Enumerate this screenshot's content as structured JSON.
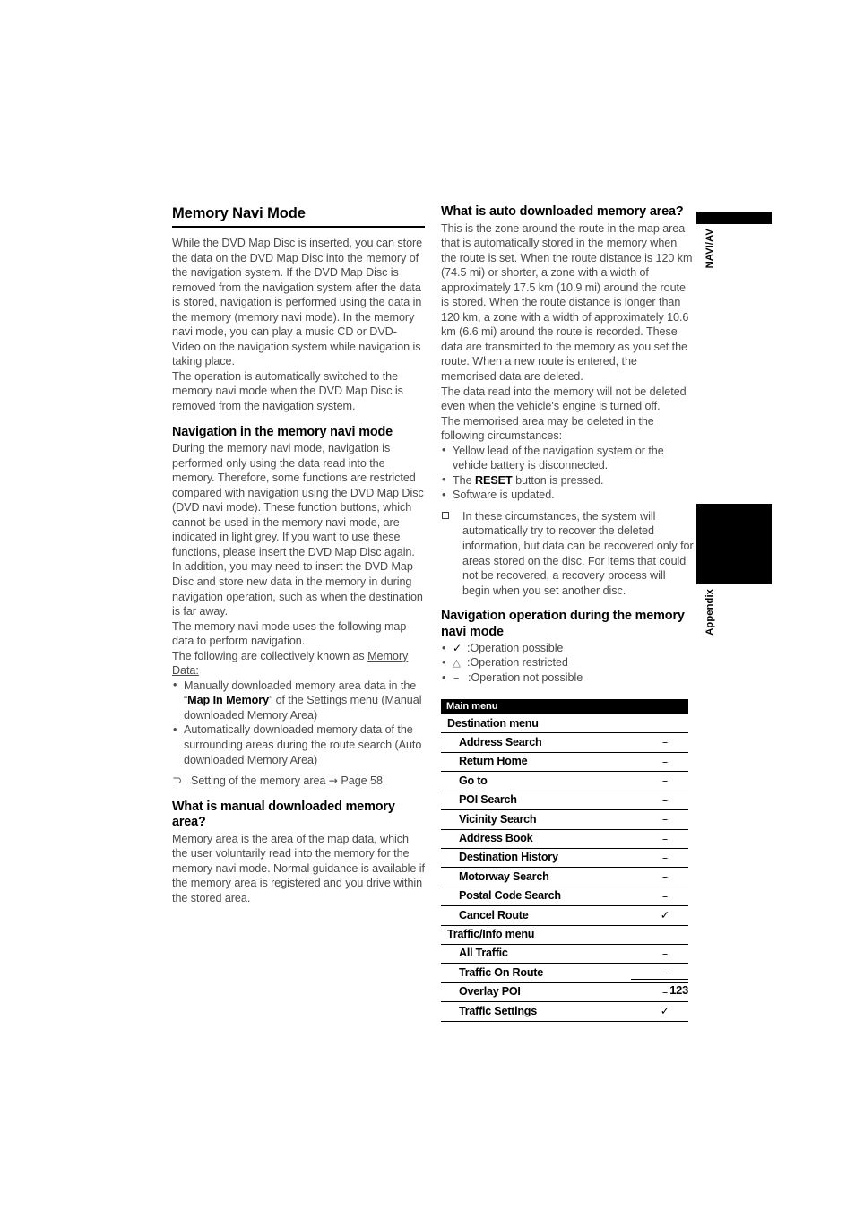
{
  "document": {
    "page_number": "123"
  },
  "margin_tabs": [
    {
      "label": "NAVI/AV"
    },
    {
      "label": "Appendix"
    }
  ],
  "left_column": {
    "title": "Memory Navi Mode",
    "intro_paragraphs": [
      "While the DVD Map Disc is inserted, you can store the data on the DVD Map Disc into the memory of the navigation system. If the DVD Map Disc is removed from the navigation system after the data is stored, navigation is performed using the data in the memory (memory navi mode). In the memory navi mode, you can play a music CD or DVD-Video on the navigation system while navigation is taking place.",
      "The operation is automatically switched to the memory navi mode when the DVD Map Disc is removed from the navigation system."
    ],
    "nav_section": {
      "heading": "Navigation in the memory navi mode",
      "paragraph1": "During the memory navi mode, navigation is performed only using the data read into the memory. Therefore, some functions are restricted compared with navigation using the DVD Map Disc (DVD navi mode). These function buttons, which cannot be used in the memory navi mode, are indicated in light grey. If you want to use these functions, please insert the DVD Map Disc again. In addition, you may need to insert the DVD Map Disc and store new data in the memory in during navigation operation, such as when the destination is far away.",
      "paragraph2": "The memory navi mode uses the following map data to perform navigation.",
      "paragraph3_prefix": "The following are collectively known as ",
      "paragraph3_underlined": "Memory Data:",
      "bullets": [
        {
          "prefix": "Manually downloaded memory area data in the “",
          "bold": "Map In Memory",
          "suffix": "” of the Settings menu (Manual downloaded Memory Area)"
        },
        {
          "prefix": "Automatically downloaded memory data of the surrounding areas during the route search (Auto downloaded Memory Area)",
          "bold": "",
          "suffix": ""
        }
      ],
      "reference": {
        "glyph": "ref-arrow-icon",
        "text": "Setting of the memory area",
        "arrow": "→",
        "target": "Page 58"
      }
    },
    "manual_area_section": {
      "heading": "What is manual downloaded memory area?",
      "paragraph": "Memory area is the area of the map data, which the user voluntarily read into the memory for the memory navi mode. Normal guidance is available if the memory area is registered and you drive within the stored area."
    }
  },
  "right_column": {
    "auto_area_section": {
      "heading": "What is auto downloaded memory area?",
      "paragraph1": "This is the zone around the route in the map area that is automatically stored in the memory when the route is set. When the route distance is 120 km (74.5 mi) or shorter, a zone with a width of approximately 17.5 km (10.9 mi) around the route is stored. When the route distance is longer than 120 km, a zone with a width of approximately 10.6 km (6.6 mi) around the route is recorded. These data are transmitted to the memory as you set the route. When a new route is entered, the memorised data are deleted.",
      "paragraph2": "The data read into the memory will not be deleted even when the vehicle's engine is turned off.",
      "paragraph3": "The memorised area may be deleted in the following circumstances:",
      "bullets": [
        {
          "prefix": "Yellow lead of the navigation system or the vehicle battery is disconnected.",
          "bold": "",
          "suffix": ""
        },
        {
          "prefix": "The ",
          "bold": "RESET",
          "suffix": " button is pressed."
        },
        {
          "prefix": "Software is updated.",
          "bold": "",
          "suffix": ""
        }
      ],
      "note": "In these circumstances, the system will automatically try to recover the deleted information, but data can be recovered only for areas stored on the disc. For items that could not be recovered, a recovery process will begin when you set another disc."
    },
    "operation_section": {
      "heading": "Navigation operation during the memory navi mode",
      "legend": [
        {
          "symbol": "✓",
          "symbol_name": "check-icon",
          "text": ":Operation possible"
        },
        {
          "symbol": "△",
          "symbol_name": "triangle-icon",
          "text": ":Operation restricted"
        },
        {
          "symbol": "–",
          "symbol_name": "dash-icon",
          "text": ":Operation not possible"
        }
      ]
    },
    "menu_table": {
      "header": "Main menu",
      "rows": [
        {
          "kind": "group",
          "label": "Destination menu",
          "mark": ""
        },
        {
          "kind": "item",
          "label": "Address Search",
          "mark": "–"
        },
        {
          "kind": "item",
          "label": "Return Home",
          "mark": "–"
        },
        {
          "kind": "item",
          "label": "Go to",
          "mark": "–"
        },
        {
          "kind": "item",
          "label": "POI Search",
          "mark": "–"
        },
        {
          "kind": "item",
          "label": "Vicinity Search",
          "mark": "–"
        },
        {
          "kind": "item",
          "label": "Address Book",
          "mark": "–"
        },
        {
          "kind": "item",
          "label": "Destination History",
          "mark": "–"
        },
        {
          "kind": "item",
          "label": "Motorway Search",
          "mark": "–"
        },
        {
          "kind": "item",
          "label": "Postal Code Search",
          "mark": "–"
        },
        {
          "kind": "item",
          "label": "Cancel Route",
          "mark": "✓"
        },
        {
          "kind": "group",
          "label": "Traffic/Info menu",
          "mark": ""
        },
        {
          "kind": "item",
          "label": "All Traffic",
          "mark": "–"
        },
        {
          "kind": "item",
          "label": "Traffic On Route",
          "mark": "–"
        },
        {
          "kind": "item",
          "label": "Overlay POI",
          "mark": "–"
        },
        {
          "kind": "item",
          "label": "Traffic Settings",
          "mark": "✓"
        }
      ]
    }
  }
}
